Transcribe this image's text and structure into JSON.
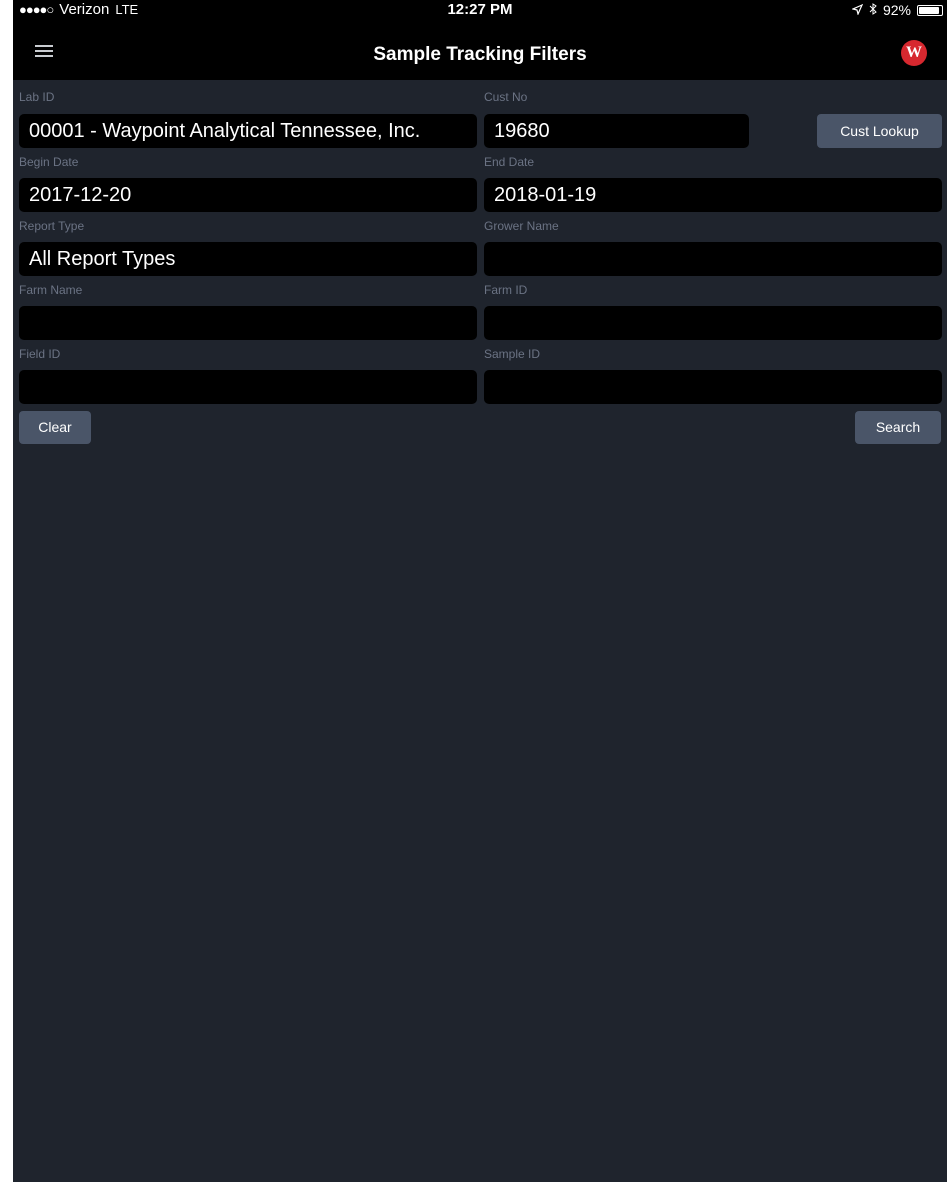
{
  "status_bar": {
    "signal": "●●●●○",
    "carrier": "Verizon",
    "network": "LTE",
    "time": "12:27 PM",
    "location_icon": "location-arrow-icon",
    "bluetooth_icon": "bluetooth-icon",
    "battery": "92%",
    "battery_level": 0.92
  },
  "nav": {
    "title": "Sample Tracking Filters",
    "logo_letter": "W",
    "logo_color": "#d7282f"
  },
  "form": {
    "lab_id_label": "Lab ID",
    "lab_id_value": "00001 - Waypoint Analytical Tennessee, Inc.",
    "cust_no_label": "Cust No",
    "cust_no_value": "19680",
    "cust_lookup_label": "Cust Lookup",
    "begin_date_label": "Begin Date",
    "begin_date_value": "2017-12-20",
    "end_date_label": "End Date",
    "end_date_value": "2018-01-19",
    "report_type_label": "Report Type",
    "report_type_value": "All Report Types",
    "grower_name_label": "Grower Name",
    "grower_name_value": "",
    "farm_name_label": "Farm Name",
    "farm_name_value": "",
    "farm_id_label": "Farm ID",
    "farm_id_value": "",
    "field_id_label": "Field ID",
    "field_id_value": "",
    "sample_id_label": "Sample ID",
    "sample_id_value": "",
    "clear_label": "Clear",
    "search_label": "Search"
  }
}
